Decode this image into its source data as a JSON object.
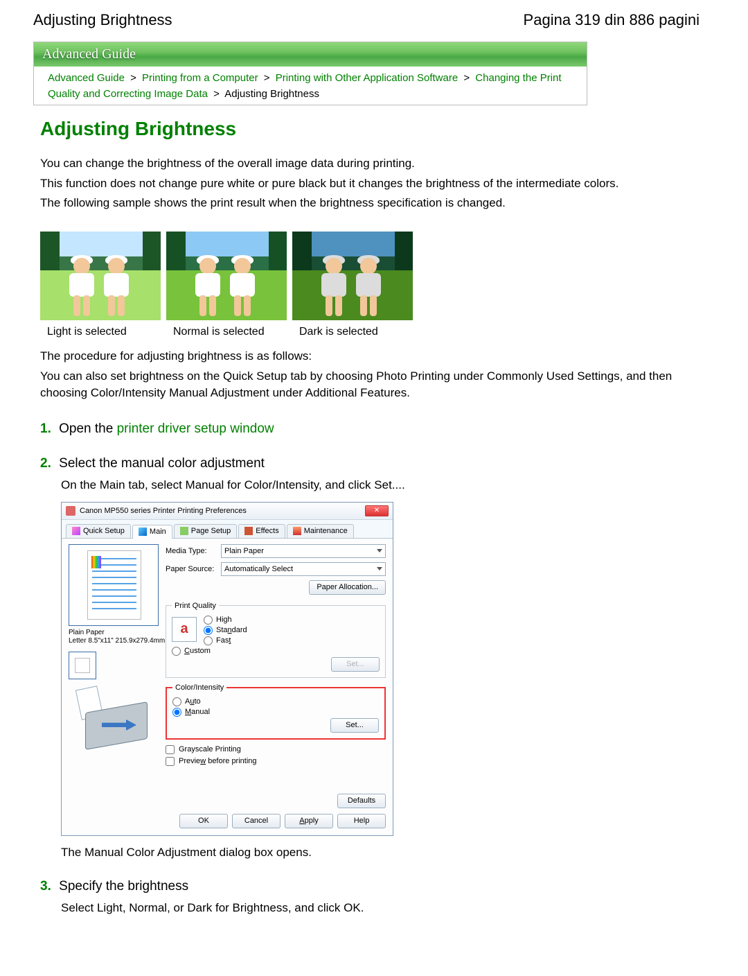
{
  "header": {
    "title_left": "Adjusting Brightness",
    "title_right": "Pagina 319 din 886 pagini"
  },
  "banner": "Advanced Guide",
  "breadcrumb": {
    "p1": "Advanced Guide",
    "p2": "Printing from a Computer",
    "p3": "Printing with Other Application Software",
    "p4": "Changing the Print Quality and Correcting Image Data",
    "current": "Adjusting Brightness",
    "sep": ">"
  },
  "title": "Adjusting Brightness",
  "intro": {
    "l1": "You can change the brightness of the overall image data during printing.",
    "l2": "This function does not change pure white or pure black but it changes the brightness of the intermediate colors.",
    "l3": "The following sample shows the print result when the brightness specification is changed."
  },
  "samples": {
    "light": "Light is selected",
    "normal": "Normal is selected",
    "dark": "Dark is selected"
  },
  "after_samples": {
    "l1": "The procedure for adjusting brightness is as follows:",
    "l2": "You can also set brightness on the Quick Setup tab by choosing Photo Printing under Commonly Used Settings, and then choosing Color/Intensity Manual Adjustment under Additional Features."
  },
  "steps": {
    "s1": {
      "num": "1.",
      "text_pre": "Open the ",
      "link": "printer driver setup window"
    },
    "s2": {
      "num": "2.",
      "title": "Select the manual color adjustment",
      "desc": "On the Main tab, select Manual for Color/Intensity, and click Set....",
      "after": "The Manual Color Adjustment dialog box opens."
    },
    "s3": {
      "num": "3.",
      "title": "Specify the brightness",
      "desc": "Select Light, Normal, or Dark for Brightness, and click OK."
    }
  },
  "dialog": {
    "title": "Canon MP550 series Printer Printing Preferences",
    "tabs": {
      "quick": "Quick Setup",
      "main": "Main",
      "page": "Page Setup",
      "effects": "Effects",
      "maint": "Maintenance"
    },
    "media_label": "Media Type:",
    "media_value": "Plain Paper",
    "source_label": "Paper Source:",
    "source_value": "Automatically Select",
    "paper_alloc": "Paper Allocation...",
    "quality": {
      "legend": "Print Quality",
      "high": "High",
      "standard": "Standard",
      "fast": "Fast",
      "custom": "Custom",
      "set": "Set...",
      "icon_letter": "a"
    },
    "color": {
      "legend": "Color/Intensity",
      "auto": "Auto",
      "manual": "Manual",
      "set": "Set..."
    },
    "grayscale": "Grayscale Printing",
    "preview_chk": "Preview before printing",
    "preview_info_l1": "Plain Paper",
    "preview_info_l2": "Letter 8.5\"x11\" 215.9x279.4mm",
    "defaults": "Defaults",
    "ok": "OK",
    "cancel": "Cancel",
    "apply": "Apply",
    "help": "Help"
  }
}
